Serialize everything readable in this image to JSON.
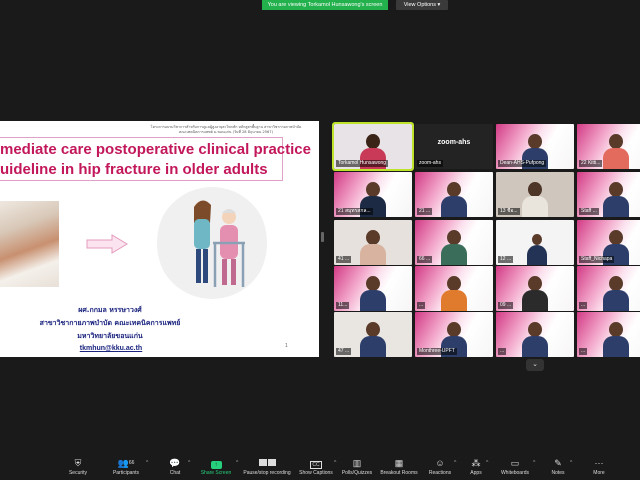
{
  "banner": {
    "text": "You are viewing Torkamol Hunsawong's screen",
    "view_options": "View Options"
  },
  "slide": {
    "header_line1": "โครงการอบรมวิชาการสำหรับการดูแลผู้สูงอายุสะโพกหัก หลักสูตรพื้นฐาน สาขาวิชากายภาพบำบัด",
    "header_line2": "คณะเทคนิคการแพทย์ ม.ขอนแก่น (วันที่ 28 มิถุนายน 2567)",
    "title_line1": "mediate care postoperative clinical practice",
    "title_line2": "uideline in hip fracture in older adults",
    "author": "ผศ.กกมล  หรรษาวงศ์",
    "department": "สาขาวิชากายภาพบำบัด คณะเทคนิคการแพทย์",
    "university": "มหาวิทยาลัยขอนแก่น",
    "email": "tkmhun@kku.ac.th",
    "page_number": "1"
  },
  "gallery": {
    "tiles": [
      {
        "name": "Torkamol Hunsawong",
        "style": "active"
      },
      {
        "name": "zoom-ahs",
        "style": "dark",
        "big": "zoom-ahs"
      },
      {
        "name": "Dean-AHS-Pufpong",
        "style": "pink"
      },
      {
        "name": "22 Kitti...",
        "style": "pink"
      },
      {
        "name": "21 สมุทรสกล...",
        "style": "pink"
      },
      {
        "name": "21 ...",
        "style": "pink"
      },
      {
        "name": "13 ชื่อ...",
        "style": "light"
      },
      {
        "name": "Staff ...",
        "style": "pink"
      },
      {
        "name": "41 ...",
        "style": "light"
      },
      {
        "name": "66 ...",
        "style": "pink"
      },
      {
        "name": "12 ...",
        "style": "dark"
      },
      {
        "name": "Staff_Nichapa",
        "style": "pink"
      },
      {
        "name": "11...",
        "style": "pink"
      },
      {
        "name": "...",
        "style": "pink"
      },
      {
        "name": "09 ...",
        "style": "pink"
      },
      {
        "name": "...",
        "style": "pink"
      },
      {
        "name": "47 ...",
        "style": "light"
      },
      {
        "name": "Monthree-UPFT",
        "style": "pink"
      },
      {
        "name": "...",
        "style": "pink"
      },
      {
        "name": "...",
        "style": "pink"
      }
    ]
  },
  "toolbar": {
    "security": "Security",
    "participants": "Participants",
    "participants_count": "66",
    "chat": "Chat",
    "share_screen": "Share Screen",
    "record": "Pause/stop recording",
    "captions": "Show Captions",
    "polls": "Polls/Quizzes",
    "breakout": "Breakout Rooms",
    "reactions": "Reactions",
    "apps": "Apps",
    "whiteboards": "Whiteboards",
    "notes": "Notes",
    "more": "More"
  },
  "colors": {
    "banner": "#22b14c",
    "active_speaker": "#bde32a",
    "share": "#26d07c",
    "title": "#c2185b"
  }
}
